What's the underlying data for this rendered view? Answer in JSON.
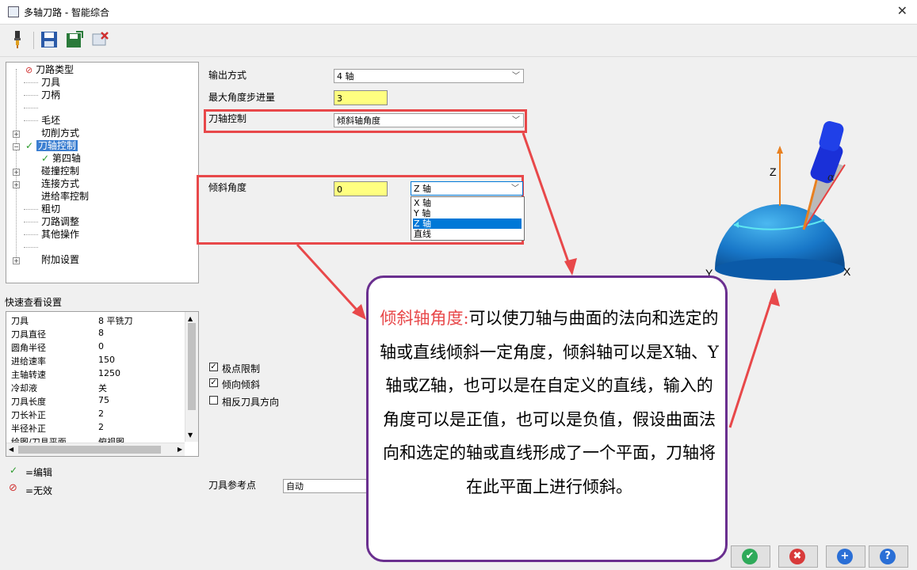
{
  "window": {
    "title": "多轴刀路 - 智能综合",
    "close_glyph": "✕"
  },
  "toolbar": {
    "icons": [
      "tool-icon",
      "save-icon",
      "save-as-icon",
      "delete-icon"
    ]
  },
  "tree": {
    "items": [
      {
        "label": "刀路类型",
        "status": "invalid"
      },
      {
        "label": "刀具"
      },
      {
        "label": "刀柄"
      },
      {
        "label": ""
      },
      {
        "label": "毛坯"
      },
      {
        "label": "切削方式",
        "expandable": true
      },
      {
        "label": "刀轴控制",
        "expandable": true,
        "status": "edited",
        "selected": true
      },
      {
        "label": "第四轴",
        "status": "edited"
      },
      {
        "label": "碰撞控制",
        "expandable": true
      },
      {
        "label": "连接方式",
        "expandable": true
      },
      {
        "label": "进给率控制"
      },
      {
        "label": "粗切"
      },
      {
        "label": "刀路调整"
      },
      {
        "label": "其他操作"
      },
      {
        "label": ""
      },
      {
        "label": "附加设置",
        "expandable": true
      }
    ]
  },
  "quick_view": {
    "title": "快速查看设置",
    "rows": [
      {
        "key": "刀具",
        "value": "8 平铣刀"
      },
      {
        "key": "刀具直径",
        "value": "8"
      },
      {
        "key": "圆角半径",
        "value": "0"
      },
      {
        "key": "进给速率",
        "value": "150"
      },
      {
        "key": "主轴转速",
        "value": "1250"
      },
      {
        "key": "冷却液",
        "value": "关"
      },
      {
        "key": "刀具长度",
        "value": "75"
      },
      {
        "key": "刀长补正",
        "value": "2"
      },
      {
        "key": "半径补正",
        "value": "2"
      },
      {
        "key": "绘图/刀具平面",
        "value": "俯视图"
      }
    ]
  },
  "legend": {
    "edited": "=编辑",
    "invalid": "=无效"
  },
  "form": {
    "output_label": "输出方式",
    "output_value": "4 轴",
    "max_step_label": "最大角度步进量",
    "max_step_value": "3",
    "axis_ctrl_label": "刀轴控制",
    "axis_ctrl_value": "倾斜轴角度",
    "tilt_label": "倾斜角度",
    "tilt_value": "0",
    "tilt_axis_value": "Z 轴",
    "tilt_axis_options": [
      "X 轴",
      "Y 轴",
      "Z 轴",
      "直线"
    ],
    "tilt_axis_selected_index": 2,
    "checkboxes": [
      {
        "label": "极点限制",
        "checked": true
      },
      {
        "label": "倾向倾斜",
        "checked": true
      },
      {
        "label": "相反刀具方向",
        "checked": false
      }
    ],
    "ref_point_label": "刀具参考点",
    "ref_point_value": "自动"
  },
  "diagram": {
    "z_label": "Z",
    "x_label": "X",
    "y_label": "Y",
    "alpha_label": "α"
  },
  "callout": {
    "heading": "倾斜轴角度:",
    "body": "可以使刀轴与曲面的法向和选定的轴或直线倾斜一定角度，倾斜轴可以是X轴、Y轴或Z轴，也可以是在自定义的直线，输入的角度可以是正值，也可以是负值，假设曲面法向和选定的轴或直线形成了一个平面，刀轴将在此平面上进行倾斜。"
  },
  "buttons": {
    "ok": "✔",
    "cancel": "✖",
    "add": "+",
    "help": "?"
  },
  "colors": {
    "accent_red": "#e8484a",
    "callout_border": "#6a2f8f",
    "input_yellow": "#ffff80",
    "select_blue": "#0078d7"
  }
}
